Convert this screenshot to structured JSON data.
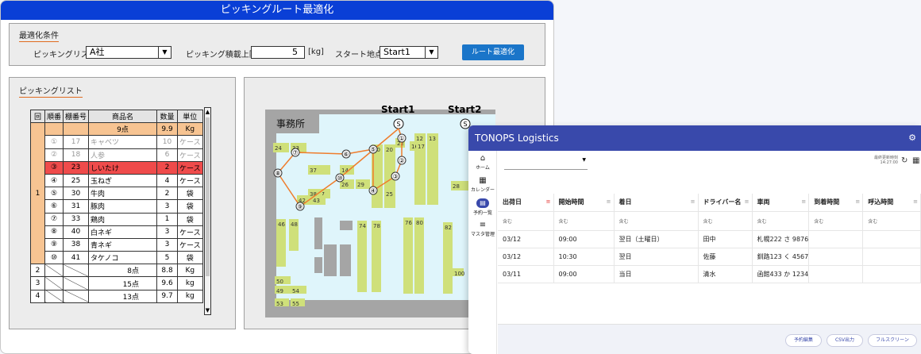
{
  "app": {
    "title": "ピッキングルート最適化"
  },
  "conditions": {
    "title": "最適化条件",
    "list_label": "ピッキングリスト",
    "list_value": "A社",
    "weight_label": "ピッキング積載上限",
    "weight_value": "5",
    "weight_unit": "[kg]",
    "start_label": "スタート地点",
    "start_value": "Start1",
    "optimize_button": "ルート最適化"
  },
  "picking_list": {
    "title": "ピッキングリスト",
    "headers": [
      "回",
      "順番",
      "棚番号",
      "商品名",
      "数量",
      "単位"
    ],
    "group1": {
      "round": "1",
      "summary_name": "9点",
      "summary_qty": "9.9",
      "summary_unit": "Kg"
    },
    "rows": [
      {
        "order": "①",
        "shelf": "17",
        "name": "キャベツ",
        "qty": "10",
        "unit": "ケース"
      },
      {
        "order": "②",
        "shelf": "18",
        "name": "人参",
        "qty": "6",
        "unit": "ケース"
      },
      {
        "order": "③",
        "shelf": "23",
        "name": "しいたけ",
        "qty": "2",
        "unit": "ケース"
      },
      {
        "order": "④",
        "shelf": "25",
        "name": "玉ねぎ",
        "qty": "4",
        "unit": "ケース"
      },
      {
        "order": "⑤",
        "shelf": "30",
        "name": "牛肉",
        "qty": "2",
        "unit": "袋"
      },
      {
        "order": "⑥",
        "shelf": "31",
        "name": "豚肉",
        "qty": "3",
        "unit": "袋"
      },
      {
        "order": "⑦",
        "shelf": "33",
        "name": "鶏肉",
        "qty": "1",
        "unit": "袋"
      },
      {
        "order": "⑧",
        "shelf": "40",
        "name": "白ネギ",
        "qty": "3",
        "unit": "ケース"
      },
      {
        "order": "⑨",
        "shelf": "38",
        "name": "青ネギ",
        "qty": "3",
        "unit": "ケース"
      },
      {
        "order": "⑩",
        "shelf": "41",
        "name": "タケノコ",
        "qty": "5",
        "unit": "袋"
      }
    ],
    "other_groups": [
      {
        "round": "2",
        "name": "8点",
        "qty": "8.8",
        "unit": "Kg"
      },
      {
        "round": "3",
        "name": "15点",
        "qty": "9.6",
        "unit": "kg"
      },
      {
        "round": "4",
        "name": "13点",
        "qty": "9.7",
        "unit": "kg"
      }
    ],
    "scroll_up": "▲",
    "scroll_down": "▼"
  },
  "map": {
    "office_label": "事務所",
    "start1_label": "Start1",
    "start2_label": "Start2",
    "start_marker": "S",
    "shelves": [
      {
        "t": "24"
      },
      {
        "t": "33"
      },
      {
        "t": "37"
      },
      {
        "t": "27"
      },
      {
        "t": "26"
      },
      {
        "t": "29"
      },
      {
        "t": "14"
      },
      {
        "t": "10"
      },
      {
        "t": "20"
      },
      {
        "t": "12"
      },
      {
        "t": "13"
      },
      {
        "t": "28"
      },
      {
        "t": "22"
      },
      {
        "t": "25"
      },
      {
        "t": "16"
      },
      {
        "t": "17"
      },
      {
        "t": "42"
      },
      {
        "t": "43"
      },
      {
        "t": "38"
      },
      {
        "t": "46"
      },
      {
        "t": "48"
      },
      {
        "t": "50"
      },
      {
        "t": "49"
      },
      {
        "t": "53"
      },
      {
        "t": "55"
      },
      {
        "t": "54"
      },
      {
        "t": "74"
      },
      {
        "t": "78"
      },
      {
        "t": "76"
      },
      {
        "t": "80"
      },
      {
        "t": "82"
      },
      {
        "t": "100"
      }
    ],
    "route_stops": [
      "①",
      "②",
      "③",
      "④",
      "⑤",
      "⑥",
      "⑦",
      "⑧",
      "⑨",
      "⑩"
    ]
  },
  "tops": {
    "title": "TONOPS Logistics",
    "nav": [
      {
        "icon": "⌂",
        "label": "ホーム"
      },
      {
        "icon": "▦",
        "label": "カレンダー"
      },
      {
        "icon": "▤",
        "label": "予約一覧"
      },
      {
        "icon": "≡",
        "label": "マスタ管理"
      }
    ],
    "last_update_label": "最終更新時刻",
    "last_update_time": "14:27:00",
    "columns": [
      "出荷日",
      "開始時間",
      "着日",
      "ドライバー名",
      "車両",
      "到着時間",
      "呼込時間"
    ],
    "filter_placeholder": "含む",
    "rows": [
      [
        "03/12",
        "09:00",
        "翌日（土曜日）",
        "田中",
        "札幌222 さ 9876",
        "",
        ""
      ],
      [
        "03/12",
        "10:30",
        "翌日",
        "佐藤",
        "釧路123 く 4567",
        "",
        ""
      ],
      [
        "03/11",
        "09:00",
        "当日",
        "清水",
        "函館433 か 1234",
        "",
        ""
      ]
    ],
    "buttons": {
      "edit": "予約編集",
      "csv": "CSV出力",
      "fullscreen": "フルスクリーン"
    },
    "accent_color": "#3949ab"
  }
}
